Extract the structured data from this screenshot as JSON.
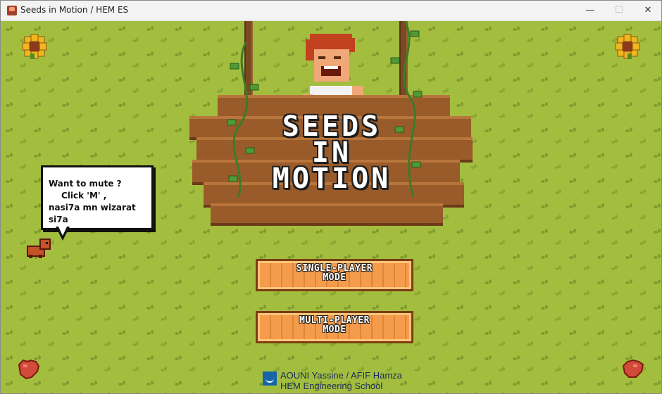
{
  "window": {
    "title": "Seeds in Motion / HEM ES",
    "controls": {
      "minimize": "—",
      "maximize": "☐",
      "close": "✕"
    }
  },
  "game": {
    "title_lines": [
      "SEEDS",
      "IN",
      "MOTION"
    ],
    "speech_bubble": {
      "line1": "Want to mute ?",
      "line2": "Click 'M' ,",
      "line3": "nasi7a mn wizarat si7a"
    },
    "buttons": {
      "single_player": [
        "SINGLE-PLAYER",
        "MODE"
      ],
      "multi_player": [
        "MULTI-PLAYER",
        "MODE"
      ]
    },
    "credits": {
      "line1": "AOUNI Yassine / AFIF Hamza",
      "line2": "HEM Engineering School"
    }
  },
  "colors": {
    "grass": "#a3be3f",
    "wood": "#9a5b2a",
    "button": "#f49c4c",
    "credits_text": "#1a2a5a"
  },
  "icons": [
    "app-icon",
    "sunflower-icon",
    "heart-icon",
    "pet-icon",
    "school-logo-icon"
  ]
}
